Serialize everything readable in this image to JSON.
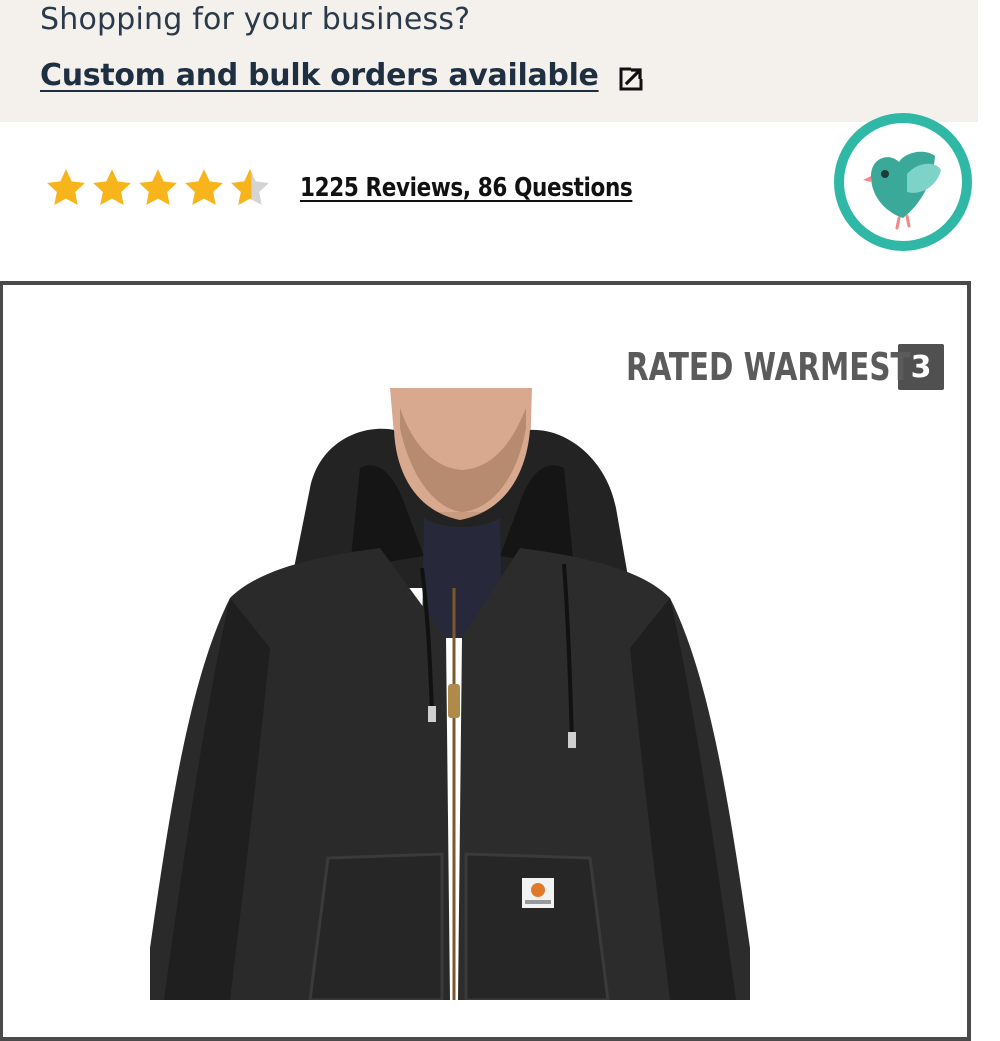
{
  "business_banner": {
    "question": "Shopping for your business?",
    "link_label": "Custom and bulk orders available",
    "link_icon": "external-link-icon"
  },
  "reviews": {
    "rating": 4.5,
    "max_rating": 5,
    "link_label": "1225 Reviews, 86 Questions",
    "star_color": "#f7b51b",
    "star_empty_color": "#d4d4d4"
  },
  "badge": {
    "icon": "bird-icon",
    "ring_color": "#2fb8a6",
    "bird_color": "#3aa99a"
  },
  "product": {
    "rated_label": "RATED WARMEST",
    "rank": "3",
    "image": "hooded-jacket-photo",
    "patch_label": "carhartt"
  }
}
